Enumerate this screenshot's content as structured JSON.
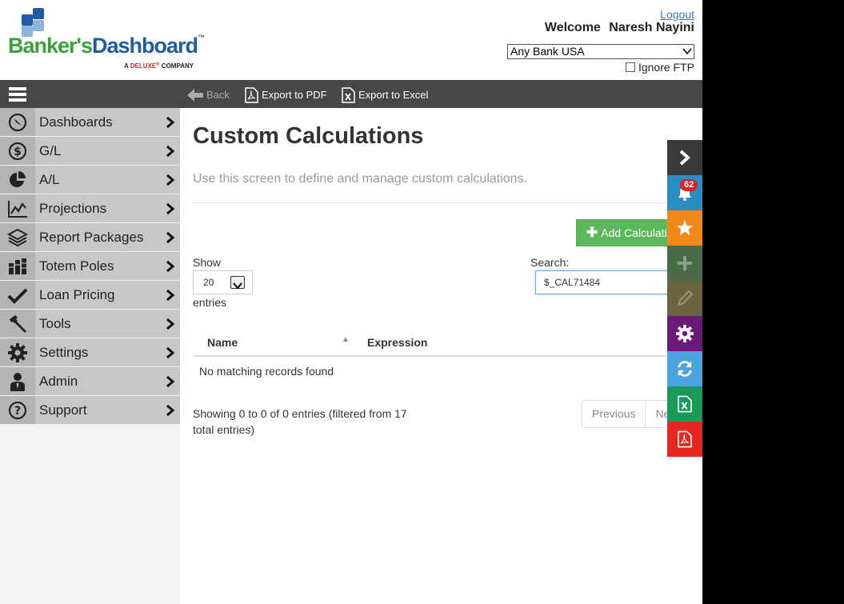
{
  "header": {
    "logo_part1": "Banker's",
    "logo_part2": "Dashboard",
    "logo_tm": "™",
    "logo_sub_prefix": "A ",
    "logo_sub_brand": "DELUXE",
    "logo_sub_mark": "®",
    "logo_sub_suffix": " COMPANY",
    "logout": "Logout",
    "welcome_label": "Welcome",
    "user_name": "Naresh Nayini",
    "bank_selected": "Any Bank USA",
    "ignore_ftp": "Ignore FTP",
    "ignore_ftp_checked": false
  },
  "toolbar": {
    "back": "Back",
    "export_pdf": "Export to PDF",
    "export_excel": "Export to Excel"
  },
  "sidebar": {
    "items": [
      {
        "label": "Dashboards",
        "icon": "compass-icon"
      },
      {
        "label": "G/L",
        "icon": "dollar-icon"
      },
      {
        "label": "A/L",
        "icon": "pie-chart-icon"
      },
      {
        "label": "Projections",
        "icon": "line-chart-icon"
      },
      {
        "label": "Report Packages",
        "icon": "layers-icon"
      },
      {
        "label": "Totem Poles",
        "icon": "bar-chart-icon"
      },
      {
        "label": "Loan Pricing",
        "icon": "check-icon"
      },
      {
        "label": "Tools",
        "icon": "hammer-icon"
      },
      {
        "label": "Settings",
        "icon": "gear-icon"
      },
      {
        "label": "Admin",
        "icon": "user-icon"
      },
      {
        "label": "Support",
        "icon": "question-icon"
      }
    ]
  },
  "main": {
    "title": "Custom Calculations",
    "description": "Use this screen to define and manage custom calculations.",
    "add_button": "Add Calculation",
    "show_label": "Show",
    "page_length": "20",
    "entries_label": "entries",
    "search_label": "Search:",
    "search_value": "$_CAL71484",
    "columns": [
      "Name",
      "Expression"
    ],
    "empty_message": "No matching records found",
    "info": "Showing 0 to 0 of 0 entries (filtered from 17 total entries)",
    "pager": {
      "previous": "Previous",
      "next": "Next"
    }
  },
  "quickbar": {
    "notification_count": "62",
    "colors": {
      "expand": "#3a3a3a",
      "notifications": "#2b8cc4",
      "favorites": "#f0881a",
      "add": "#4a6a4a",
      "edit": "#6a6240",
      "settings": "#6a1b7a",
      "refresh": "#4aa3df",
      "excel": "#1a9a5a",
      "pdf": "#e5281f"
    }
  }
}
